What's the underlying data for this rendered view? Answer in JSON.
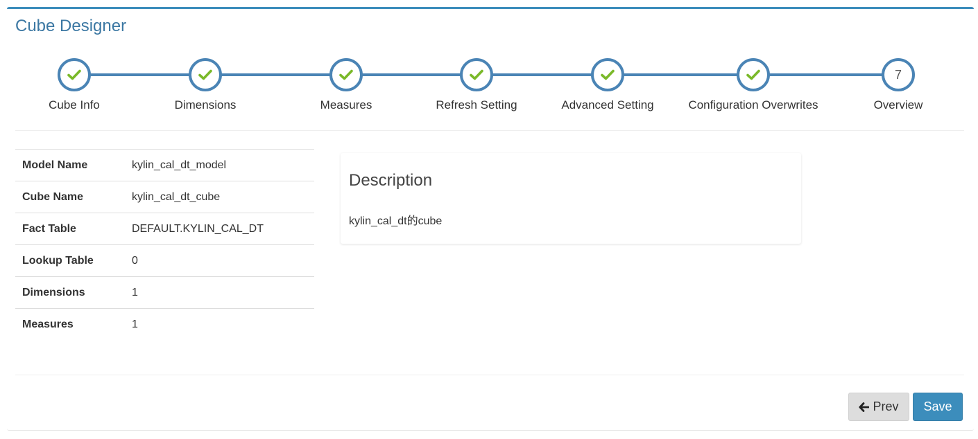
{
  "panel": {
    "title": "Cube Designer"
  },
  "wizard": {
    "steps": [
      {
        "label": "Cube Info",
        "state": "done",
        "icon": "check-icon"
      },
      {
        "label": "Dimensions",
        "state": "done",
        "icon": "check-icon"
      },
      {
        "label": "Measures",
        "state": "done",
        "icon": "check-icon"
      },
      {
        "label": "Refresh Setting",
        "state": "done",
        "icon": "check-icon"
      },
      {
        "label": "Advanced Setting",
        "state": "done",
        "icon": "check-icon"
      },
      {
        "label": "Configuration Overwrites",
        "state": "done",
        "icon": "check-icon"
      },
      {
        "label": "Overview",
        "state": "current",
        "number": "7"
      }
    ],
    "colors": {
      "line": "#4a84b5",
      "check": "#7ab929"
    }
  },
  "summary": {
    "rows": [
      {
        "key": "Model Name",
        "value": "kylin_cal_dt_model"
      },
      {
        "key": "Cube Name",
        "value": "kylin_cal_dt_cube"
      },
      {
        "key": "Fact Table",
        "value": "DEFAULT.KYLIN_CAL_DT"
      },
      {
        "key": "Lookup Table",
        "value": "0"
      },
      {
        "key": "Dimensions",
        "value": "1"
      },
      {
        "key": "Measures",
        "value": "1"
      }
    ]
  },
  "description": {
    "title": "Description",
    "text": "kylin_cal_dt的cube"
  },
  "actions": {
    "prev_label": "Prev",
    "prev_icon": "arrow-left-icon",
    "save_label": "Save",
    "save_color": "#3c8dbc"
  }
}
